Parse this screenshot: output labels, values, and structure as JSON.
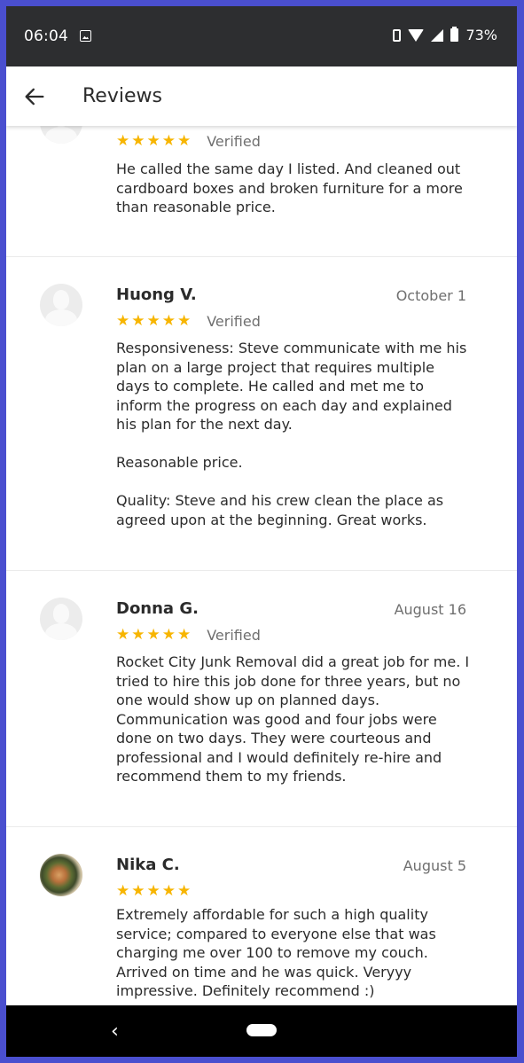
{
  "status_bar": {
    "time": "06:04",
    "icons": [
      "image-icon",
      "vibrate-icon",
      "wifi-icon",
      "signal-icon",
      "battery-icon"
    ],
    "battery": "73%"
  },
  "app_bar": {
    "back_icon": "arrow-left-icon",
    "title": "Reviews"
  },
  "reviews": [
    {
      "name": "",
      "date": "",
      "rating": 5,
      "stars": "★★★★★",
      "verified": "Verified",
      "text": "He called the same day I listed. And cleaned out cardboard boxes and broken furniture for a more than reasonable price."
    },
    {
      "name": "Huong V.",
      "date": "October 1",
      "rating": 5,
      "stars": "★★★★★",
      "verified": "Verified",
      "text": "Responsiveness: Steve communicate with me his plan on a large project that requires multiple days to complete. He called and met me to inform the progress on each day and explained his plan for the next day.\n\nReasonable price.\n\nQuality: Steve and his crew clean the place as agreed upon at the beginning. Great works."
    },
    {
      "name": "Donna G.",
      "date": "August 16",
      "rating": 5,
      "stars": "★★★★★",
      "verified": "Verified",
      "text": "Rocket City Junk Removal did a great job for me. I tried to hire this job done for three years, but no one would show up on planned days. Communication was good and four jobs were done on two days. They were courteous and professional and I would definitely re-hire and recommend them to my friends."
    },
    {
      "name": "Nika C.",
      "date": "August 5",
      "rating": 5,
      "stars": "★★★★★",
      "verified": "",
      "text": "Extremely affordable for such a high quality service; compared to everyone else that was charging me over 100 to remove my couch. Arrived on time and he was quick. Veryyy impressive. Definitely recommend :)"
    }
  ],
  "nav_bar": {
    "back_icon": "nav-back-icon",
    "home_icon": "home-pill-icon"
  },
  "colors": {
    "accent_frame": "#4a4fcf",
    "status_bar": "#2d2e30",
    "star": "#f7b500"
  }
}
